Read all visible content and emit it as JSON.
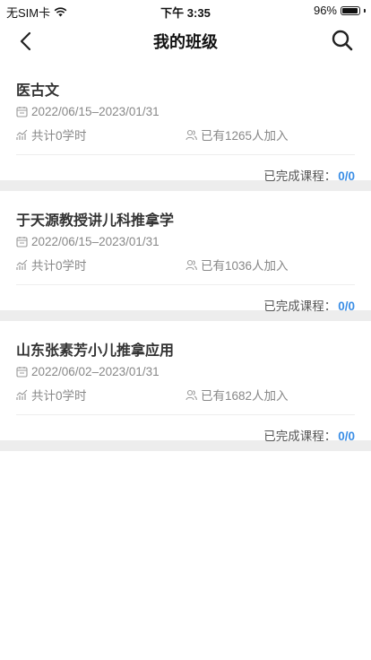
{
  "status_bar": {
    "carrier": "无SIM卡",
    "time": "下午 3:35",
    "battery": "96%",
    "battery_level": 0.96
  },
  "nav": {
    "title": "我的班级",
    "back_icon": "chevron-left-icon",
    "search_icon": "search-icon"
  },
  "classes": [
    {
      "title": "医古文",
      "date_range": "2022/06/15–2023/01/31",
      "hours": "共计0学时",
      "joined": "已有1265人加入",
      "completed_label": "已完成课程：",
      "completed_value": "0/0"
    },
    {
      "title": "于天源教授讲儿科推拿学",
      "date_range": "2022/06/15–2023/01/31",
      "hours": "共计0学时",
      "joined": "已有1036人加入",
      "completed_label": "已完成课程：",
      "completed_value": "0/0"
    },
    {
      "title": "山东张素芳小儿推拿应用",
      "date_range": "2022/06/02–2023/01/31",
      "hours": "共计0学时",
      "joined": "已有1682人加入",
      "completed_label": "已完成课程：",
      "completed_value": "0/0"
    }
  ],
  "colors": {
    "accent": "#3a8ee6",
    "separator": "#ededed",
    "meta_text": "#888888"
  }
}
